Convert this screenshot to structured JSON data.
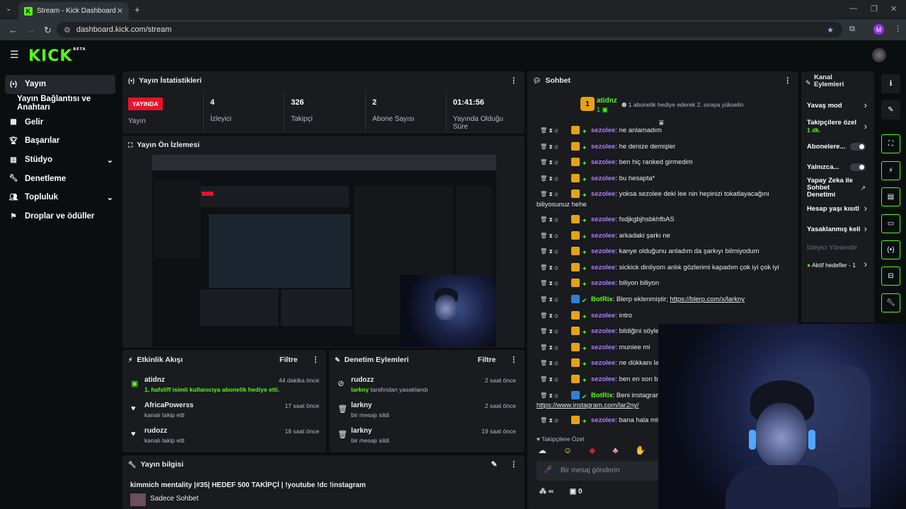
{
  "browser": {
    "tab_title": "Stream - Kick Dashboard",
    "url": "dashboard.kick.com/stream",
    "profile_initial": "M"
  },
  "brand": {
    "logo": "KICK",
    "beta": "BETA",
    "accent": "#53fc18"
  },
  "sidebar": {
    "items": [
      {
        "label": "Yayın"
      },
      {
        "label": "Yayın Bağlantısı ve Anahtarı"
      },
      {
        "label": "Gelir"
      },
      {
        "label": "Başarılar"
      },
      {
        "label": "Stüdyo"
      },
      {
        "label": "Denetleme"
      },
      {
        "label": "Topluluk"
      },
      {
        "label": "Droplar ve ödüller"
      }
    ]
  },
  "stats": {
    "title": "Yayın İstatistikleri",
    "live_badge": "YAYINDA",
    "live_label": "Yayın",
    "viewers": {
      "value": "4",
      "label": "İzleyici"
    },
    "followers": {
      "value": "326",
      "label": "Takipçi"
    },
    "subs": {
      "value": "2",
      "label": "Abone Sayısı"
    },
    "uptime": {
      "value": "01:41:56",
      "label": "Yayında Olduğu Süre"
    }
  },
  "preview": {
    "title": "Yayın Ön İzlemesi"
  },
  "activity": {
    "title": "Etkinlik Akışı",
    "filter": "Filtre",
    "items": [
      {
        "name": "atidnz",
        "detail": "1, hafsliff isimli kullanıcıya abonelik hediye etti.",
        "time": "44 dakika önce"
      },
      {
        "name": "AfricaPowerss",
        "detail": "kanalı takip etti",
        "time": "17 saat önce"
      },
      {
        "name": "rudozz",
        "detail": "kanalı takip etti",
        "time": "19 saat önce"
      }
    ]
  },
  "modactions": {
    "title": "Denetim Eylemleri",
    "filter": "Filtre",
    "items": [
      {
        "name": "rudozz",
        "detail_user": "larkny",
        "detail": " tarafından yasaklandı",
        "time": "2 saat önce"
      },
      {
        "name": "larkny",
        "detail": "bir mesajı sildi",
        "time": "2 saat önce"
      },
      {
        "name": "larkny",
        "detail": "bir mesajı sildi",
        "time": "19 saat önce"
      }
    ]
  },
  "streaminfo": {
    "title": "Yayın bilgisi",
    "stream_title": "kimmich mentality |#35| HEDEF 500 TAKİPÇİ | !youtube !dc !instagram",
    "category": "Sadece Sohbet"
  },
  "chat": {
    "title": "Sohbet",
    "pinned_user": "atidnz",
    "pinned_count": "1",
    "pinned_message": "1 abonelik hediye ederek 2. sıraya yükselin",
    "messages": [
      {
        "user": "sezolee",
        "text": " ne anlamadım"
      },
      {
        "user": "sezolee",
        "text": " he denize demişler"
      },
      {
        "user": "sezolee",
        "text": " ben hiç ranked girmedim"
      },
      {
        "user": "sezolee",
        "text": " bu hesapta*"
      },
      {
        "user": "sezolee",
        "text": " yoksa sezolee deki lee nin hepinizi tokatlayacağını",
        "cont": "biliyosunuz hehe"
      },
      {
        "user": "sezolee",
        "text": " fsdjkgbjhsbkhfbAS"
      },
      {
        "user": "sezolee",
        "text": " arkadaki şarkı ne"
      },
      {
        "user": "sezolee",
        "text": " kanye olduğunu anladım da şarkıyı bilmiyodum"
      },
      {
        "user": "sezolee",
        "text": " sickick dinliyom anlık gözlerimi kapadım çok iyi çok iyi"
      },
      {
        "user": "sezolee",
        "text": " biliyon biliyon"
      },
      {
        "user": "BotRix",
        "text": " Blerp eklenmiştir; ",
        "link": "https://blerp.com/x/larkny",
        "bot": true
      },
      {
        "user": "sezolee",
        "text": " intro"
      },
      {
        "user": "sezolee",
        "text": " bildiğini söyle"
      },
      {
        "user": "sezolee",
        "text": " muniee mi"
      },
      {
        "user": "sezolee",
        "text": " ne dükkanı lan"
      },
      {
        "user": "sezolee",
        "text": " ben en son bk"
      },
      {
        "user": "BotRix",
        "text": " Beni instagram",
        "cont_link": "https://www.instagram.com/lar2ny/",
        "bot": true
      },
      {
        "user": "sezolee",
        "text": " bana hala mill"
      }
    ],
    "followers_only": "Takipçilere Özel",
    "input_placeholder": "Bir mesaj gönderin",
    "footer_count": "0",
    "footer_infinity": "∞"
  },
  "channel_actions": {
    "title": "Kanal Eylemleri",
    "items": [
      {
        "label": "Yavaş mod"
      },
      {
        "label": "Takipçilere özel",
        "sub": "1 dk."
      },
      {
        "label": "Abonelere..."
      },
      {
        "label": "Yalnızca..."
      },
      {
        "label": "Yapay Zeka ile Sohbet Denetimi"
      },
      {
        "label": "Hesap yaşı kısıtl"
      },
      {
        "label": "Yasaklanmış keli"
      },
      {
        "label": "İzleyici Yönlendir"
      },
      {
        "label": "Aktif hedefler - 1"
      }
    ]
  }
}
